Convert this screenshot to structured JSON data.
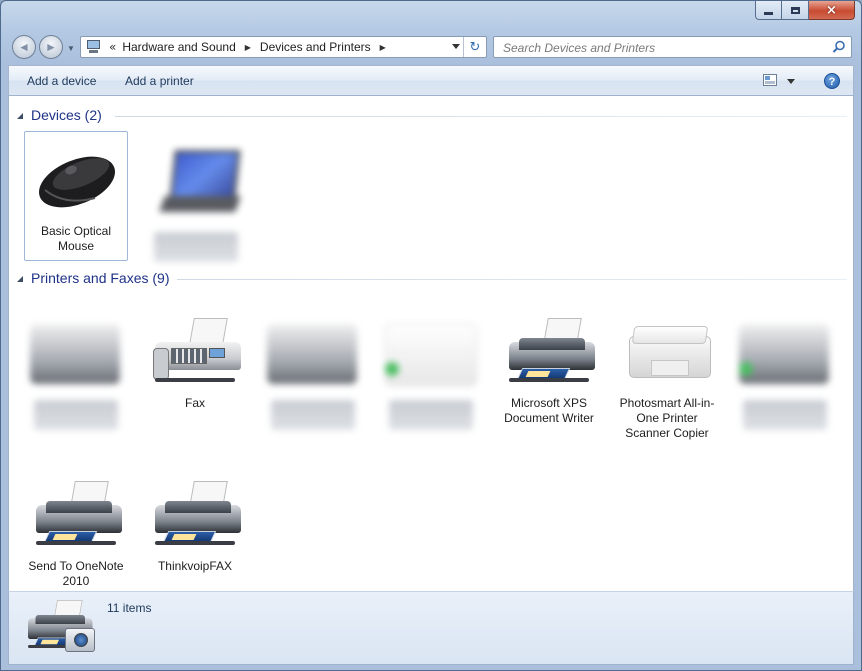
{
  "window": {
    "controls": {
      "minimize": "minimize",
      "maximize": "maximize",
      "close": "×"
    }
  },
  "nav": {
    "back_glyph": "◄",
    "forward_glyph": "►",
    "breadcrumb_chevron": "«",
    "breadcrumbs": [
      "Hardware and Sound",
      "Devices and Printers"
    ],
    "crumb_separator": "▶",
    "refresh_glyph": "↻"
  },
  "search": {
    "placeholder": "Search Devices and Printers",
    "value": ""
  },
  "toolbar": {
    "add_device": "Add a device",
    "add_printer": "Add a printer",
    "help": "?"
  },
  "groups": {
    "devices": {
      "title": "Devices (2)",
      "items": [
        {
          "label": "Basic Optical Mouse",
          "icon": "mouse-icon",
          "selected": true
        },
        {
          "label": "",
          "icon": "laptop-icon",
          "obscured": true
        }
      ]
    },
    "printers": {
      "title": "Printers and Faxes (9)",
      "items": [
        {
          "label": "",
          "icon": "printer-icon",
          "obscured": true
        },
        {
          "label": "Fax",
          "icon": "fax-icon"
        },
        {
          "label": "",
          "icon": "printer-icon",
          "obscured": true
        },
        {
          "label": "",
          "icon": "printer-icon",
          "obscured": true
        },
        {
          "label": "Microsoft XPS Document Writer",
          "icon": "printer-icon"
        },
        {
          "label": "Photosmart All-in-One Printer Scanner Copier",
          "icon": "photosmart-icon"
        },
        {
          "label": "",
          "icon": "printer-icon",
          "obscured": true
        },
        {
          "label": "Send To OneNote 2010",
          "icon": "printer-icon"
        },
        {
          "label": "ThinkvoipFAX",
          "icon": "printer-icon"
        }
      ]
    }
  },
  "details": {
    "count": "11 items"
  }
}
